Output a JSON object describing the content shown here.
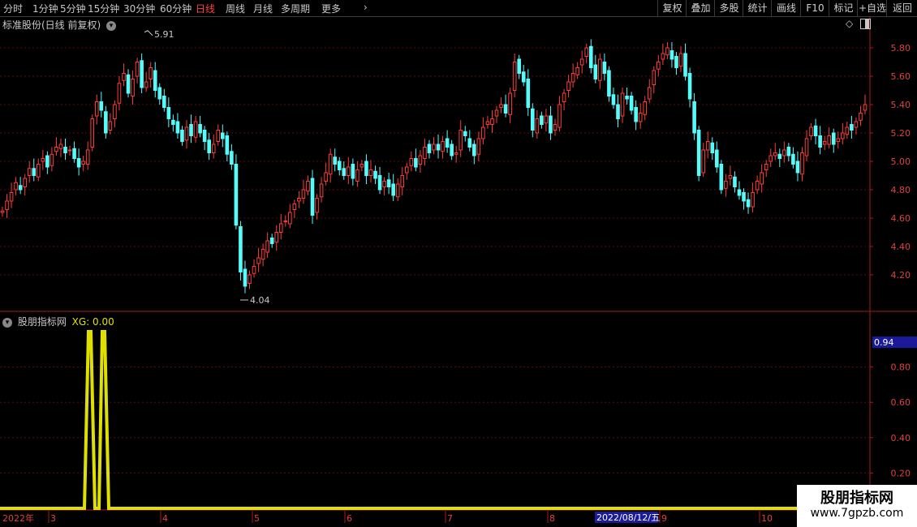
{
  "toolbar": {
    "periods": [
      "分时",
      "1分钟",
      "5分钟",
      "15分钟",
      "30分钟",
      "60分钟",
      "日线",
      "周线",
      "月线",
      "多周期",
      "更多"
    ],
    "active_period": "日线",
    "more_icon": "chevron-right-icon",
    "buttons": [
      "复权",
      "叠加",
      "多股",
      "统计",
      "画线",
      "F10",
      "标记",
      "+自选",
      "返回"
    ]
  },
  "main_chart": {
    "title": "标准股份(日线 前复权)",
    "high_label": "5.91",
    "low_label": "4.04",
    "y_ticks": [
      "5.80",
      "5.60",
      "5.40",
      "5.20",
      "5.00",
      "4.80",
      "4.60",
      "4.40",
      "4.20"
    ]
  },
  "indicator": {
    "name": "股朋指标网",
    "value_label": "XG: 0.00",
    "current_value": "0.94",
    "y_ticks": [
      "0.80",
      "0.60",
      "0.40",
      "0.20"
    ]
  },
  "x_axis": {
    "year_label": "2022年",
    "months": [
      "3",
      "4",
      "5",
      "6",
      "7",
      "8",
      "9",
      "10"
    ],
    "cursor_date": "2022/08/12/五"
  },
  "watermark": {
    "line1": "股朋指标网",
    "line2": "www.7gpzb.com"
  },
  "colors": {
    "up": "#ff3c3c",
    "down": "#54fcfc",
    "indicator_line": "#e0e000",
    "frame": "#b01818",
    "grid": "#5a0c0c",
    "active": "#ff4040"
  },
  "chart_data": {
    "type": "candlestick",
    "period": "daily",
    "price_range": [
      4.04,
      5.91
    ],
    "close_series": [
      4.65,
      4.72,
      4.78,
      4.85,
      4.8,
      4.88,
      4.95,
      4.9,
      4.98,
      5.02,
      4.96,
      5.05,
      5.1,
      5.12,
      5.06,
      5.08,
      5.02,
      4.96,
      5.0,
      5.08,
      5.3,
      5.42,
      5.36,
      5.2,
      5.28,
      5.4,
      5.55,
      5.62,
      5.48,
      5.58,
      5.7,
      5.52,
      5.56,
      5.66,
      5.5,
      5.44,
      5.38,
      5.3,
      5.26,
      5.2,
      5.14,
      5.24,
      5.18,
      5.28,
      5.2,
      5.14,
      5.06,
      5.12,
      5.22,
      5.16,
      5.05,
      4.98,
      4.55,
      4.22,
      4.12,
      4.2,
      4.26,
      4.32,
      4.38,
      4.44,
      4.42,
      4.5,
      4.56,
      4.58,
      4.64,
      4.7,
      4.74,
      4.8,
      4.86,
      4.62,
      4.74,
      4.84,
      4.92,
      5.05,
      4.98,
      4.94,
      4.9,
      4.96,
      4.88,
      4.94,
      4.98,
      4.9,
      4.94,
      4.88,
      4.8,
      4.86,
      4.82,
      4.76,
      4.84,
      4.9,
      4.96,
      5.02,
      4.96,
      5.04,
      5.1,
      5.06,
      5.12,
      5.08,
      5.14,
      5.1,
      5.04,
      5.06,
      5.22,
      5.18,
      5.1,
      5.04,
      5.16,
      5.24,
      5.28,
      5.3,
      5.36,
      5.4,
      5.34,
      5.48,
      5.7,
      5.62,
      5.56,
      5.38,
      5.22,
      5.3,
      5.26,
      5.32,
      5.2,
      5.26,
      5.4,
      5.48,
      5.56,
      5.62,
      5.66,
      5.72,
      5.8,
      5.66,
      5.58,
      5.72,
      5.62,
      5.46,
      5.4,
      5.3,
      5.48,
      5.44,
      5.36,
      5.28,
      5.34,
      5.42,
      5.52,
      5.64,
      5.7,
      5.76,
      5.8,
      5.72,
      5.66,
      5.76,
      5.6,
      5.44,
      5.2,
      4.9,
      5.08,
      5.14,
      5.06,
      4.96,
      4.8,
      4.86,
      4.9,
      4.82,
      4.76,
      4.72,
      4.68,
      4.78,
      4.86,
      4.92,
      4.98,
      5.04,
      5.06,
      5.02,
      5.08,
      5.04,
      4.98,
      4.92,
      5.06,
      5.16,
      5.24,
      5.18,
      5.1,
      5.14,
      5.18,
      5.12,
      5.16,
      5.2,
      5.24,
      5.22,
      5.28,
      5.34,
      5.4
    ],
    "xg_series_description": "XG signal mostly 0.00; two spikes reaching about 1.0 in early-to-mid March 2022",
    "indicator_y_ticks": [
      0.8,
      0.6,
      0.4,
      0.2
    ]
  }
}
